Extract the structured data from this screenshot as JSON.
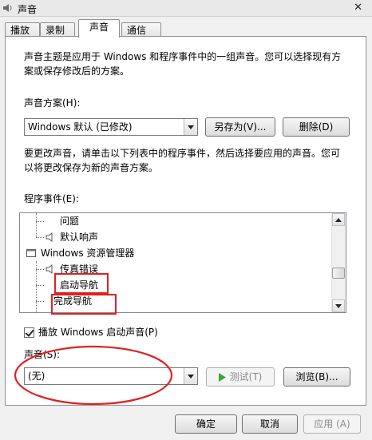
{
  "window": {
    "title": "声音",
    "close_glyph": "✕"
  },
  "tabs": [
    {
      "label": "播放",
      "active": false
    },
    {
      "label": "录制",
      "active": false
    },
    {
      "label": "声音",
      "active": true
    },
    {
      "label": "通信",
      "active": false
    }
  ],
  "intro_lines": [
    "声音主题是应用于 Windows 和程序事件中的一组声音。您可以选择现有方",
    "案或保存修改后的方案。"
  ],
  "scheme": {
    "label": "声音方案(H):",
    "value": "Windows 默认 (已修改)",
    "save_as_button": "另存为(V)...",
    "delete_button": "删除(D)"
  },
  "instruction_lines": [
    "要更改声音，请单击以下列表中的程序事件，然后选择要应用的声音。您可",
    "以将更改保存为新的声音方案。"
  ],
  "events": {
    "label": "程序事件(E):",
    "items": [
      {
        "label": "问题",
        "has_sound": false
      },
      {
        "label": "默认响声",
        "has_sound": true
      },
      {
        "label": "Windows 资源管理器",
        "group": true
      },
      {
        "label": "传真错误",
        "has_sound": true
      },
      {
        "label": "启动导航",
        "has_sound": false,
        "highlighted": true
      },
      {
        "label": "完成导航",
        "has_sound": false,
        "highlighted": true
      }
    ]
  },
  "startup_checkbox": {
    "label": "播放 Windows 启动声音(P)",
    "checked": true
  },
  "sound": {
    "label": "声音(S):",
    "value": "(无)",
    "test_button": "测试(T)",
    "browse_button": "浏览(B)..."
  },
  "footer": {
    "ok": "确定",
    "cancel": "取消",
    "apply": "应用 (A)"
  },
  "colors": {
    "annotation": "#e02020",
    "test_play_icon": "#3aa53a"
  }
}
